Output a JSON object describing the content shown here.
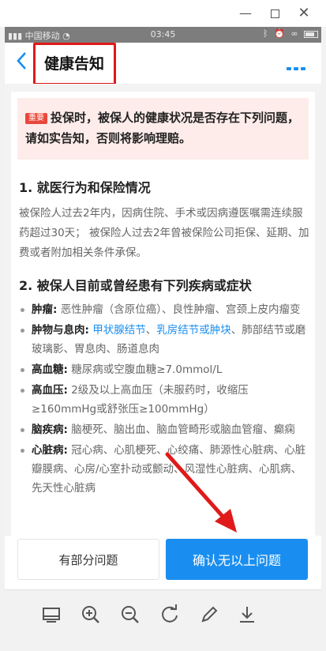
{
  "status_bar": {
    "carrier": "中国移动",
    "time": "03:45"
  },
  "header": {
    "title": "健康告知"
  },
  "notice": {
    "badge": "重要",
    "text": "投保时，被保人的健康状况是否存在下列问题，请如实告知，否则将影响理赔。"
  },
  "section1": {
    "title": "1. 就医行为和保险情况",
    "body": "被保险人过去2年内，因病住院、手术或因病遵医嘱需连续服药超过30天；  被保险人过去2年曾被保险公司拒保、延期、加费或者附加相关条件承保。"
  },
  "section2": {
    "title": "2. 被保人目前或曾经患有下列疾病或症状",
    "items": [
      {
        "name": "肿瘤:",
        "text": " 恶性肿瘤（含原位癌）、良性肿瘤、宫颈上皮内瘤变"
      },
      {
        "name": "肿物与息肉:",
        "link1": "甲状腺结节",
        "sep": "、",
        "link2": "乳房结节或肿块",
        "text": "、肺部结节或磨玻璃影、胃息肉、肠道息肉"
      },
      {
        "name": "高血糖:",
        "text": " 糖尿病或空腹血糖≥7.0mmol/L"
      },
      {
        "name": "高血压:",
        "text": " 2级及以上高血压（未服药时，收缩压≥160mmHg或舒张压≥100mmHg）"
      },
      {
        "name": "脑疾病:",
        "text": " 脑梗死、脑出血、脑血管畸形或脑血管瘤、癫痫"
      },
      {
        "name": "心脏病:",
        "text": " 冠心病、心肌梗死、心绞痛、肺源性心脏病、心脏瓣膜病、心房/心室扑动或颤动、风湿性心脏病、心肌病、先天性心脏病"
      }
    ]
  },
  "actions": {
    "partial_label": "有部分问题",
    "confirm_label": "确认无以上问题"
  },
  "colors": {
    "accent": "#1a8ef0",
    "badge": "#e8483b",
    "notice_bg": "#fdecea",
    "annotation": "#e01a1a"
  },
  "icons": {
    "window": [
      "minimize-icon",
      "maximize-icon",
      "close-icon"
    ],
    "status": [
      "wifi-icon",
      "bluetooth-icon",
      "alarm-icon",
      "battery-icon"
    ],
    "toolbar": [
      "screen-icon",
      "zoom-in-icon",
      "zoom-out-icon",
      "rotate-icon",
      "pen-icon",
      "download-icon"
    ]
  }
}
